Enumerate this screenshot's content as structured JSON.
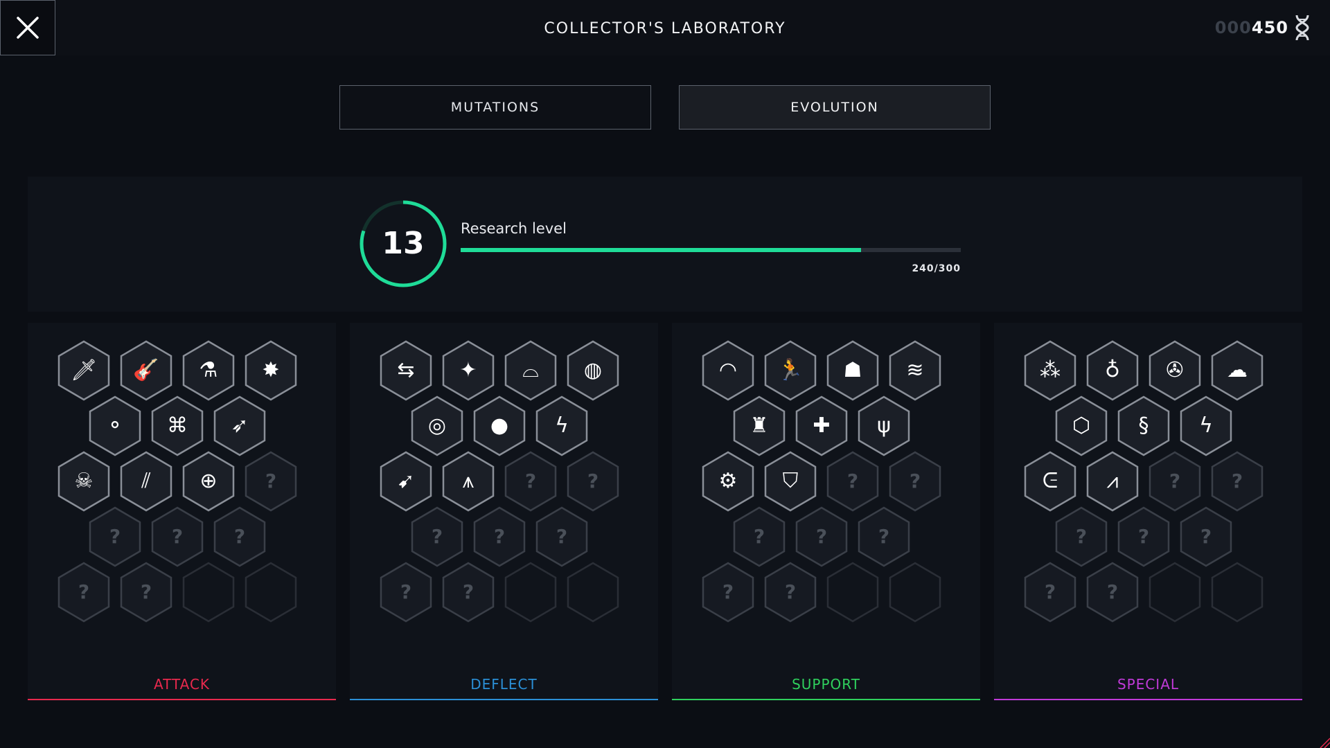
{
  "header": {
    "title": "COLLECTOR'S LABORATORY",
    "currency_prefix": "000",
    "currency_value": "450",
    "currency_icon": "dna-icon",
    "close_icon": "close-icon"
  },
  "tabs": [
    {
      "label": "MUTATIONS",
      "selected": false
    },
    {
      "label": "EVOLUTION",
      "selected": true
    }
  ],
  "research": {
    "level": "13",
    "label": "Research level",
    "progress_text": "240/300",
    "current": 240,
    "max": 300,
    "accent_color": "#1fdc98"
  },
  "categories": [
    {
      "name": "ATTACK",
      "color": "#e8294d",
      "icons": [
        "sword-icon",
        "guitar-icon",
        "flask-icon",
        "explosion-icon",
        "eggs-icon",
        "binoculars-icon",
        "rocket-icon",
        "skull-lightning-icon",
        "claw-marks-icon",
        "crosshair-icon"
      ],
      "locked_glyph": "?",
      "locked_count": 6,
      "empty_count": 2
    },
    {
      "name": "DEFLECT",
      "color": "#2b8fd6",
      "icons": [
        "deflect-arrows-icon",
        "bird-icon",
        "shell-icon",
        "armor-ball-icon",
        "portal-icon",
        "orb-icon",
        "lightning-icon",
        "slash-bird-icon",
        "spikes-icon"
      ],
      "locked_glyph": "?",
      "locked_count": 7,
      "empty_count": 2
    },
    {
      "name": "SUPPORT",
      "color": "#2fd05d",
      "icons": [
        "dome-icon",
        "runner-icon",
        "skull-mask-icon",
        "wave-icon",
        "robot-icon",
        "medical-cross-icon",
        "root-icon",
        "mech-icon",
        "shield-icon"
      ],
      "locked_glyph": "?",
      "locked_count": 7,
      "empty_count": 2
    },
    {
      "name": "SPECIAL",
      "color": "#c03ad8",
      "icons": [
        "scatter-icon",
        "planet-icon",
        "propeller-icon",
        "rocks-icon",
        "honeycomb-icon",
        "serpent-icon",
        "crack-icon",
        "tornado-icon",
        "eruption-icon"
      ],
      "locked_glyph": "?",
      "locked_count": 7,
      "empty_count": 2
    }
  ]
}
